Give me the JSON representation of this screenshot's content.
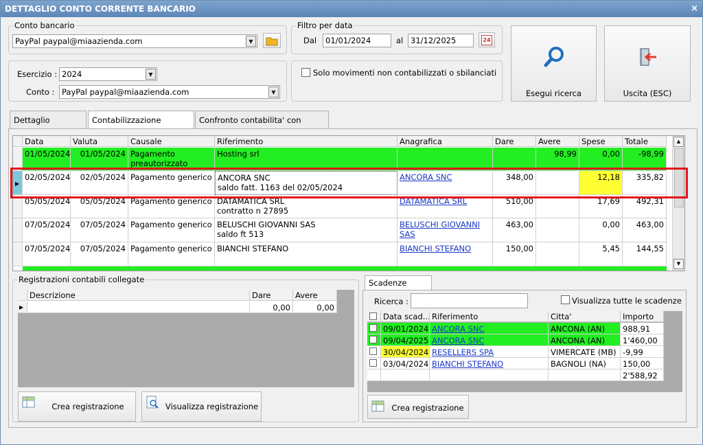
{
  "window": {
    "title": "DETTAGLIO CONTO CORRENTE BANCARIO",
    "close": "×"
  },
  "conto": {
    "caption": "Conto bancario",
    "value": "PayPal paypal@miaazienda.com"
  },
  "filtro": {
    "caption": "Filtro per data",
    "dal_label": "Dal",
    "dal": "01/01/2024",
    "al_label": "al",
    "al": "31/12/2025",
    "cal_day": "24"
  },
  "esercizio": {
    "label": "Esercizio :",
    "value": "2024",
    "conto_label": "Conto :",
    "conto_value": "PayPal paypal@miaazienda.com"
  },
  "solo_mov": {
    "label": "Solo movimenti non contabilizzati o sbilanciati"
  },
  "buttons": {
    "esegui": "Esegui ricerca",
    "uscita": "Uscita (ESC)"
  },
  "tabs": [
    "Dettaglio movimenti",
    "Contabilizzazione movimenti",
    "Confronto contabilita' con movimenti"
  ],
  "movimenti": {
    "headers": [
      "Data",
      "Valuta",
      "Causale",
      "Riferimento",
      "Anagrafica",
      "Dare",
      "Avere",
      "Spese",
      "Totale"
    ],
    "rows": [
      {
        "data": "01/05/2024",
        "valuta": "01/05/2024",
        "causale": "Pagamento\npreautorizzato",
        "rif": "Hosting srl",
        "ana": "",
        "dare": "",
        "avere": "98,99",
        "spese": "0,00",
        "totale": "-98,99",
        "color": "#22ee22"
      },
      {
        "data": "02/05/2024",
        "valuta": "02/05/2024",
        "causale": "Pagamento generico",
        "rif": "ANCORA SNC\nsaldo fatt.    1163 del 02/05/2024",
        "ana": "ANCORA SNC",
        "dare": "348,00",
        "avere": "",
        "spese": "12,18",
        "totale": "335,82",
        "color": "#ffffff"
      },
      {
        "data": "05/05/2024",
        "valuta": "05/05/2024",
        "causale": "Pagamento generico",
        "rif": "DATAMATICA SRL\ncontratto n 27895",
        "ana": "DATAMATICA SRL",
        "dare": "510,00",
        "avere": "",
        "spese": "17,69",
        "totale": "492,31",
        "color": "#ffffff"
      },
      {
        "data": "07/05/2024",
        "valuta": "07/05/2024",
        "causale": "Pagamento generico",
        "rif": "BELUSCHI GIOVANNI SAS\nsaldo ft 513",
        "ana": "BELUSCHI GIOVANNI SAS",
        "dare": "463,00",
        "avere": "",
        "spese": "0,00",
        "totale": "463,00",
        "color": "#ffffff"
      },
      {
        "data": "07/05/2024",
        "valuta": "07/05/2024",
        "causale": "Pagamento generico",
        "rif": "BIANCHI STEFANO",
        "ana": "BIANCHI STEFANO",
        "dare": "150,00",
        "avere": "",
        "spese": "5,45",
        "totale": "144,55",
        "color": "#ffffff"
      }
    ]
  },
  "registrazioni": {
    "caption": "Registrazioni contabili collegate",
    "headers": [
      "Descrizione",
      "Dare",
      "Avere"
    ],
    "row": {
      "desc": "",
      "dare": "0,00",
      "avere": "0,00"
    },
    "btn_crea": "Crea registrazione",
    "btn_vis": "Visualizza registrazione"
  },
  "scadenze": {
    "tab": "Scadenze aperte",
    "ricerca_label": "Ricerca :",
    "ricerca_value": "",
    "visualizza_label": "Visualizza tutte le scadenze",
    "headers": [
      "Data scad...",
      "Riferimento",
      "Citta'",
      "Importo"
    ],
    "rows": [
      {
        "data": "09/01/2024",
        "rif": "ANCORA SNC",
        "citta": "ANCONA (AN)",
        "importo": "988,91",
        "color": "#22ee22",
        "datecolor": ""
      },
      {
        "data": "09/04/2025",
        "rif": "ANCORA SNC",
        "citta": "ANCONA (AN)",
        "importo": "1'460,00",
        "color": "#22ee22",
        "datecolor": ""
      },
      {
        "data": "30/04/2024",
        "rif": "RESELLERS SPA",
        "citta": "VIMERCATE (MB)",
        "importo": "-9,99",
        "color": "#ffffff",
        "datecolor": "#ffff33"
      },
      {
        "data": "03/04/2024",
        "rif": "BIANCHI STEFANO",
        "citta": "BAGNOLI (NA)",
        "importo": "150,00",
        "color": "#ffffff",
        "datecolor": ""
      }
    ],
    "total": "2'588,92",
    "btn_crea": "Crea registrazione"
  }
}
